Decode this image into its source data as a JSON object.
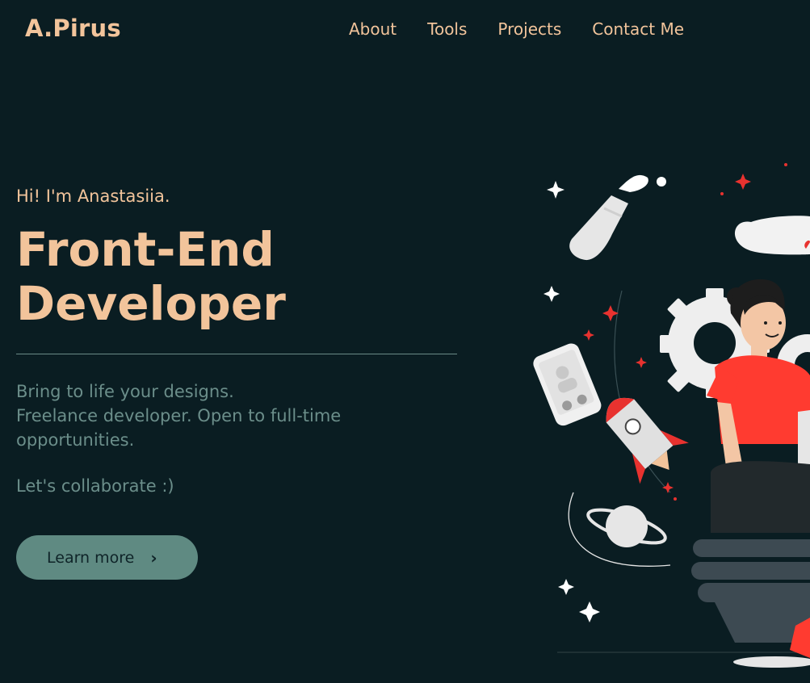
{
  "header": {
    "logo": "A.Pirus",
    "nav": [
      "About",
      "Tools",
      "Projects",
      "Contact Me"
    ]
  },
  "hero": {
    "greeting": "Hi! I'm Anastasiia.",
    "title_line1": "Front-End",
    "title_line2": "Developer",
    "description_line1": "Bring to life your designs.",
    "description_line2": "Freelance developer. Open to full-time",
    "description_line3": "opportunities.",
    "collaborate": "Let's collaborate :)",
    "cta_label": "Learn more",
    "cta_icon": "chevron-right-icon"
  },
  "colors": {
    "background": "#0a1d22",
    "accent": "#f2c49b",
    "muted_text": "#6b8e8a",
    "button": "#5f8a82",
    "illustration_red": "#e8322f"
  }
}
